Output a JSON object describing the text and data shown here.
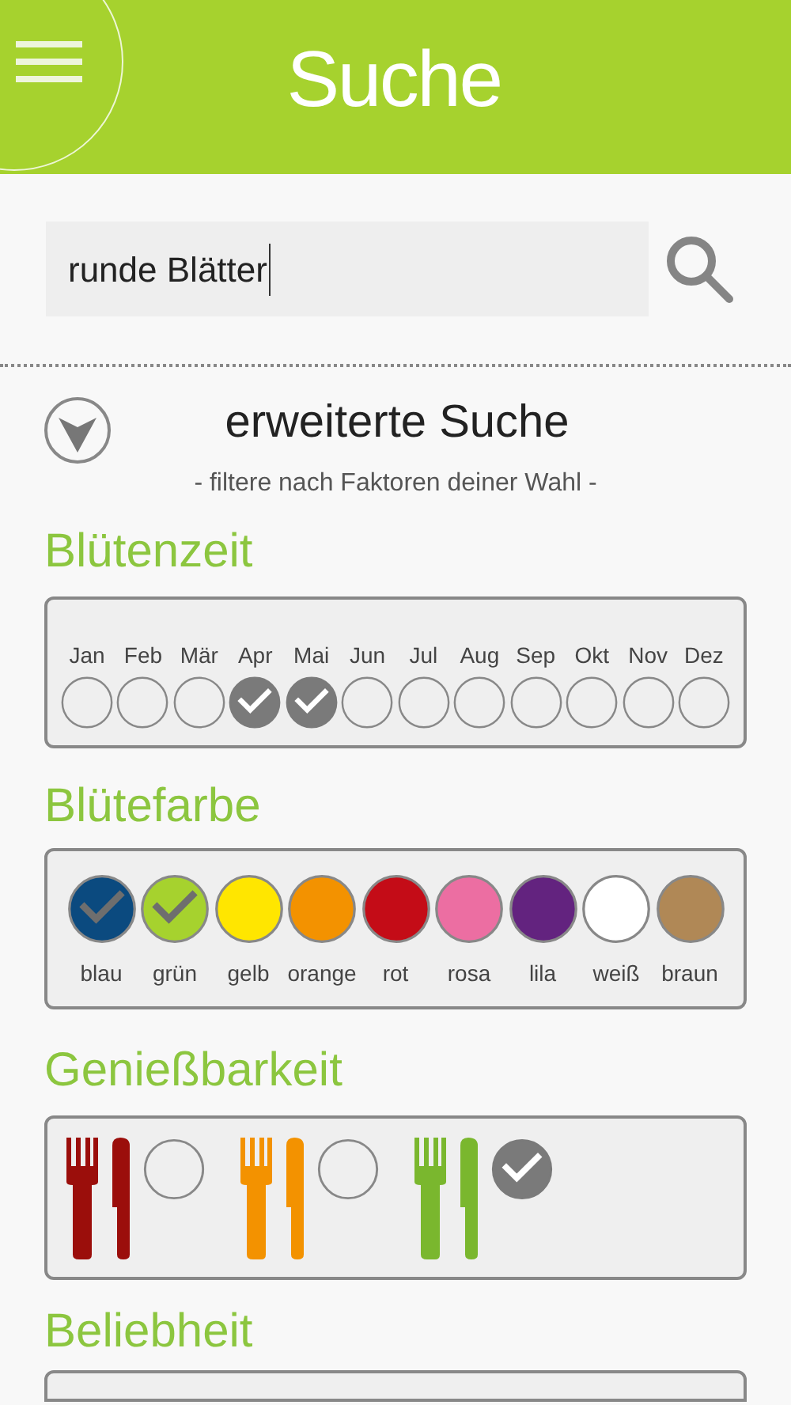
{
  "header": {
    "title": "Suche"
  },
  "search": {
    "value": "runde Blätter"
  },
  "advanced": {
    "title": "erweiterte Suche",
    "subtitle": "- filtere nach Faktoren deiner Wahl -",
    "expanded": true
  },
  "bloom_time": {
    "heading": "Blütenzeit",
    "months": [
      {
        "label": "Jan",
        "checked": false
      },
      {
        "label": "Feb",
        "checked": false
      },
      {
        "label": "Mär",
        "checked": false
      },
      {
        "label": "Apr",
        "checked": true
      },
      {
        "label": "Mai",
        "checked": true
      },
      {
        "label": "Jun",
        "checked": false
      },
      {
        "label": "Jul",
        "checked": false
      },
      {
        "label": "Aug",
        "checked": false
      },
      {
        "label": "Sep",
        "checked": false
      },
      {
        "label": "Okt",
        "checked": false
      },
      {
        "label": "Nov",
        "checked": false
      },
      {
        "label": "Dez",
        "checked": false
      }
    ]
  },
  "bloom_color": {
    "heading": "Blütefarbe",
    "colors": [
      {
        "label": "blau",
        "color": "#0b4a7f",
        "checked": true
      },
      {
        "label": "grün",
        "color": "#a6d22e",
        "checked": true
      },
      {
        "label": "gelb",
        "color": "#ffe600",
        "checked": false
      },
      {
        "label": "orange",
        "color": "#f39200",
        "checked": false
      },
      {
        "label": "rot",
        "color": "#c40c17",
        "checked": false
      },
      {
        "label": "rosa",
        "color": "#ec6ea2",
        "checked": false
      },
      {
        "label": "lila",
        "color": "#63237f",
        "checked": false
      },
      {
        "label": "weiß",
        "color": "#ffffff",
        "checked": false
      },
      {
        "label": "braun",
        "color": "#b08856",
        "checked": false
      }
    ]
  },
  "edibility": {
    "heading": "Genießbarkeit",
    "options": [
      {
        "color": "#9b0e0b",
        "checked": false
      },
      {
        "color": "#f39200",
        "checked": false
      },
      {
        "color": "#7ab72e",
        "checked": true
      }
    ]
  },
  "popularity": {
    "heading": "Beliebheit"
  }
}
